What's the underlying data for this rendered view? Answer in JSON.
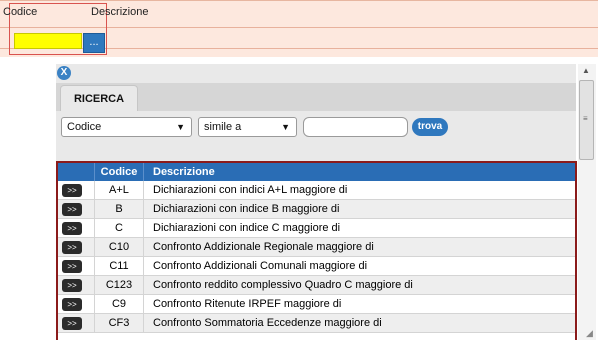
{
  "filter_bar": {
    "codice_label": "Codice",
    "descrizione_label": "Descrizione",
    "lookup_button_label": "..."
  },
  "panel": {
    "close_label": "X",
    "tab_label": "RICERCA",
    "field_select_value": "Codice",
    "operator_select_value": "simile a",
    "search_input_value": "",
    "search_button_label": "trova",
    "select_arrow": "▼"
  },
  "table": {
    "headers": {
      "code": "Codice",
      "description": "Descrizione"
    },
    "row_button_label": ">>",
    "rows": [
      {
        "code": "A+L",
        "description": "Dichiarazioni con indici A+L maggiore di"
      },
      {
        "code": "B",
        "description": "Dichiarazioni con indice B maggiore di"
      },
      {
        "code": "C",
        "description": "Dichiarazioni con indice C maggiore di"
      },
      {
        "code": "C10",
        "description": "Confronto Addizionale Regionale maggiore di"
      },
      {
        "code": "C11",
        "description": "Confronto Addizionali Comunali maggiore di"
      },
      {
        "code": "C123",
        "description": "Confronto reddito complessivo Quadro C maggiore di"
      },
      {
        "code": "C9",
        "description": "Confronto Ritenute IRPEF maggiore di"
      },
      {
        "code": "CF3",
        "description": "Confronto Sommatoria Eccedenze maggiore di"
      }
    ]
  },
  "colors": {
    "accent_blue": "#2a6db5",
    "table_border": "#8b1b1b",
    "highlight_input": "#ffff00",
    "filter_bar_bg": "#fde8de"
  }
}
